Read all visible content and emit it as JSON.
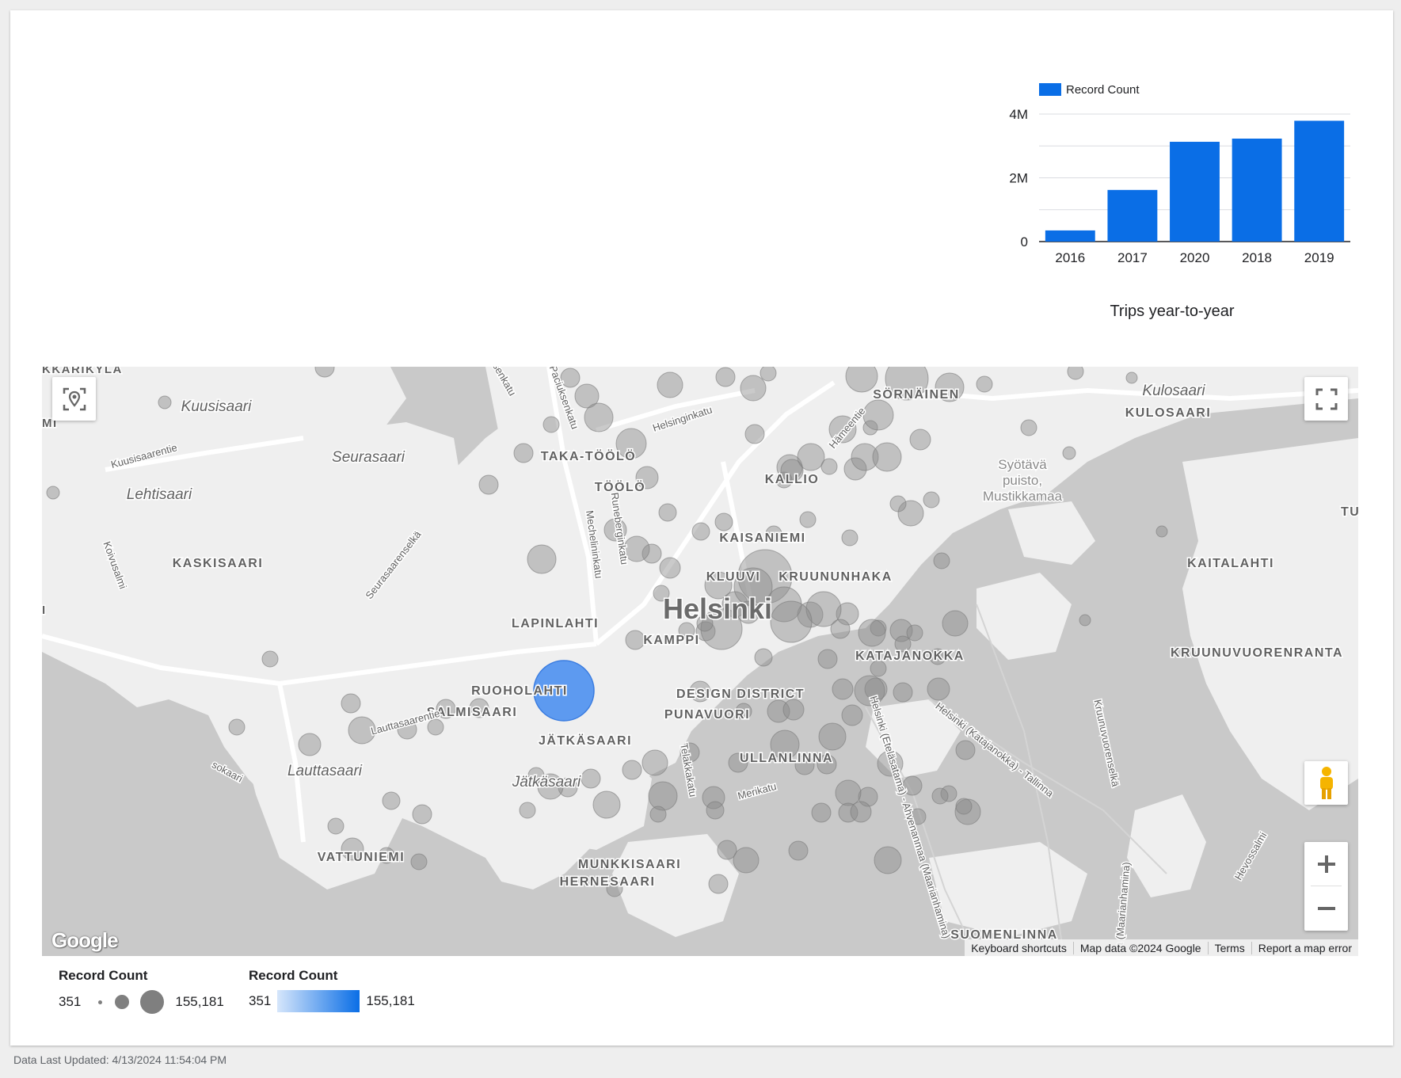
{
  "chart_data": {
    "type": "bar",
    "title": "Trips year-to-year",
    "legend": {
      "label": "Record Count",
      "position": "top-left"
    },
    "categories": [
      "2016",
      "2017",
      "2020",
      "2018",
      "2019"
    ],
    "series": [
      {
        "name": "Record Count",
        "values": [
          350000,
          1620000,
          3130000,
          3230000,
          3790000
        ]
      }
    ],
    "yticks": [
      "0",
      "2M",
      "4M"
    ],
    "ylim": [
      0,
      4000000
    ],
    "grid": true,
    "colors": {
      "bar": "#0a6ee6"
    }
  },
  "map": {
    "labels": {
      "kkarikyla": "KKARIKYLÄ",
      "kuusisaari": "Kuusisaari",
      "seurasaari": "Seurasaari",
      "lehtisaari": "Lehtisaari",
      "kaskisaari": "KASKISAARI",
      "taka_toolo": "TAKA-TÖÖLÖ",
      "toolo": "TÖÖLÖ",
      "kallio": "KALLIO",
      "sornainen": "SÖRNÄINEN",
      "kulosaari_it": "Kulosaari",
      "kulosaari": "KULOSAARI",
      "syotava": "Syötävä",
      "puisto": "puisto,",
      "mustikkamaa": "Mustikkamaa",
      "tullisaari": "TULLISAA",
      "kaitalahti": "KAITALAHTI",
      "kaisaniemi": "KAISANIEMI",
      "kluuvi": "KLUUVI",
      "kruununhaka": "KRUUNUNHAKA",
      "helsinki": "Helsinki",
      "lapinlahti": "LAPINLAHTI",
      "kamppi": "KAMPPI",
      "katajanokka": "KATAJANOKKA",
      "kruunuvuorenranta": "KRUUNUVUORENRANTA",
      "ruoholahti": "RUOHOLAHTI",
      "salmisaari": "SALMISAARI",
      "design_district": "DESIGN DISTRICT",
      "punavuori": "PUNAVUORI",
      "jatkasaari": "JÄTKÄSAARI",
      "jatkasaari_it": "Jätkäsaari",
      "ullanlinna": "ULLANLINNA",
      "lauttasaari": "Lauttasaari",
      "vattuniemi": "VATTUNIEMI",
      "munkkisaari": "MUNKKISAARI",
      "hernesaari": "HERNESAARI",
      "suomenlinna": "SUOMENLINNA",
      "helsinginkatu": "Helsinginkatu",
      "hameentie": "Hämeentie",
      "mechelininkatu": "Mechelininkatu",
      "runeberginkatu": "Runeberginkatu",
      "kuusisaarentie": "Kuusisaarentie",
      "lauttasaarentie": "Lauttasaarentie",
      "seurasaarenselka": "Seurasaarenselkä",
      "koivusalmi": "Koivusalmi",
      "telakkakatu": "Telakkakatu",
      "merikatu": "Merikatu",
      "helsinki_eteläsatama": "Helsinki (Eteläsatama) - Ahvenanmaa (Maarianhamina)",
      "helsinki_katajanokka": "Helsinki (Katajanokka) - Tallinna",
      "kruunuvuorenselka": "Kruunuvuorenselkä",
      "hevossalmi": "Hevossalmi",
      "senkatu": "senkatu",
      "ltasaari": "sokaari",
      "maarianhamina": "a (Maarianhamina)",
      "mi": "MI",
      "i": "I",
      "sankatu": "Paciuksenkatu"
    },
    "attribution": {
      "shortcuts": "Keyboard shortcuts",
      "data": "Map data ©2024 Google",
      "terms": "Terms",
      "report": "Report a map error"
    },
    "logo": "Google",
    "highlight_color": "#4d90f0",
    "bubble_color": "#8a8a8a"
  },
  "legend_size": {
    "title": "Record Count",
    "min": "351",
    "max": "155,181"
  },
  "legend_color": {
    "title": "Record Count",
    "min": "351",
    "max": "155,181"
  },
  "footer": {
    "updated": "Data Last Updated: 4/13/2024 11:54:04 PM"
  }
}
